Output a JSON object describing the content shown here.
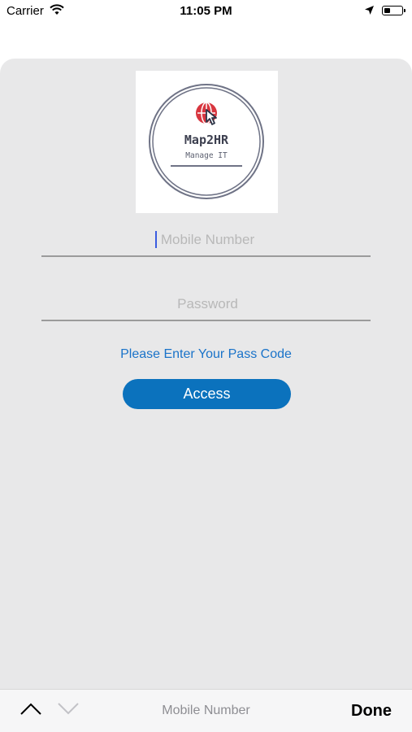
{
  "status_bar": {
    "carrier": "Carrier",
    "time": "11:05 PM",
    "battery_level": 0.35
  },
  "logo": {
    "name": "Map2HR",
    "tagline": "Manage IT"
  },
  "form": {
    "mobile_placeholder": "Mobile Number",
    "password_placeholder": "Password",
    "passcode_link": "Please Enter Your Pass Code",
    "access_label": "Access"
  },
  "toolbar": {
    "field_label": "Mobile Number",
    "done_label": "Done"
  },
  "colors": {
    "accent": "#0b72bd",
    "link": "#1a73c9",
    "card_bg": "#e8e8e9"
  }
}
